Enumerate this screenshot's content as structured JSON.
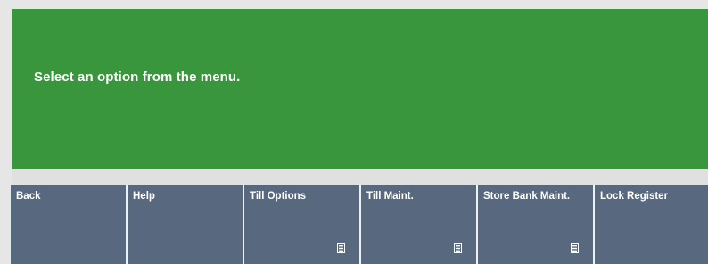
{
  "prompt": {
    "message": "Select an option from the menu."
  },
  "menu": {
    "buttons": [
      {
        "label": "Back",
        "has_submenu": false
      },
      {
        "label": "Help",
        "has_submenu": false
      },
      {
        "label": "Till Options",
        "has_submenu": true,
        "icon": "submenu-icon"
      },
      {
        "label": "Till Maint.",
        "has_submenu": true,
        "icon": "submenu-icon"
      },
      {
        "label": "Store Bank Maint.",
        "has_submenu": true,
        "icon": "submenu-icon"
      },
      {
        "label": "Lock Register",
        "has_submenu": false
      }
    ]
  },
  "colors": {
    "prompt_background": "#3a963c",
    "button_background": "#58697f",
    "text": "#ffffff"
  }
}
